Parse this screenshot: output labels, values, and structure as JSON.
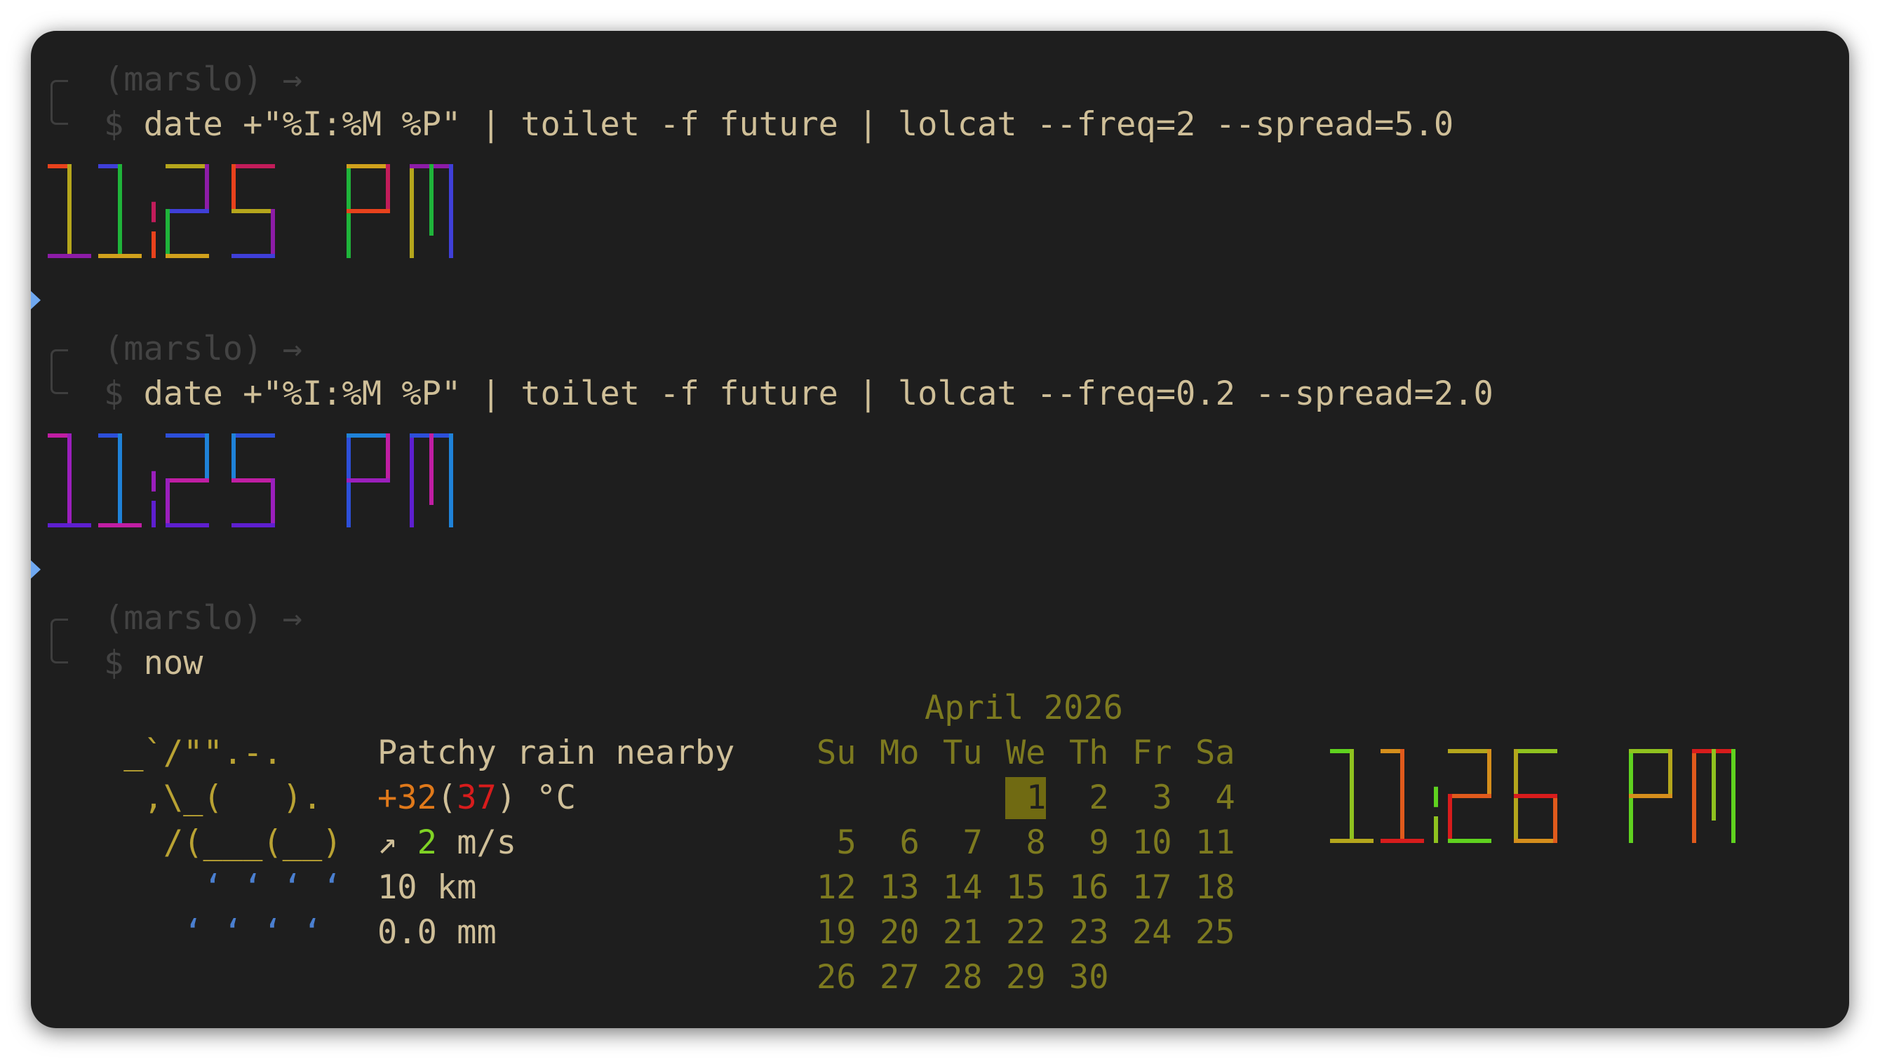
{
  "prompts": [
    {
      "context": "(marslo)",
      "arrow": "→",
      "sign": "$",
      "command": "date +\"%I:%M %P\" | toilet -f future | lolcat --freq=2 --spread=5.0"
    },
    {
      "context": "(marslo)",
      "arrow": "→",
      "sign": "$",
      "command": "date +\"%I:%M %P\" | toilet -f future | lolcat --freq=0.2 --spread=2.0"
    },
    {
      "context": "(marslo)",
      "arrow": "→",
      "sign": "$",
      "command": "now"
    }
  ],
  "clock_outputs": [
    {
      "time": "11:25 PM",
      "gradient": [
        "#e8421c",
        "#b5a61c",
        "#8d1ca7",
        "#3f3fd8",
        "#1fb43a",
        "#d0a11c",
        "#c21c5a"
      ]
    },
    {
      "time": "11:25 PM",
      "gradient": [
        "#c01ea3",
        "#9b1fbc",
        "#5e1fcf",
        "#2d4fd9",
        "#1f82d8"
      ]
    }
  ],
  "weather": {
    "art": [
      " _`/\"\".-.",
      "  ,\\_(   ).",
      "   /(___(__)",
      "     ‘ ‘ ‘ ‘",
      "    ‘ ‘ ‘ ‘"
    ],
    "condition": "Patchy rain nearby",
    "temp_prefix": "+32",
    "temp_feels": "37",
    "temp_unit": ") °C",
    "wind_arrow": "↗",
    "wind_speed": "2",
    "wind_unit": "m/s",
    "visibility": "10 km",
    "precipitation": "0.0 mm"
  },
  "calendar": {
    "title": "April 2026",
    "weekdays": [
      "Su",
      "Mo",
      "Tu",
      "We",
      "Th",
      "Fr",
      "Sa"
    ],
    "weeks": [
      [
        "",
        "",
        "",
        "1",
        "2",
        "3",
        "4"
      ],
      [
        "5",
        "6",
        "7",
        "8",
        "9",
        "10",
        "11"
      ],
      [
        "12",
        "13",
        "14",
        "15",
        "16",
        "17",
        "18"
      ],
      [
        "19",
        "20",
        "21",
        "22",
        "23",
        "24",
        "25"
      ],
      [
        "26",
        "27",
        "28",
        "29",
        "30",
        "",
        ""
      ]
    ],
    "today": "1"
  },
  "now_clock": {
    "time": "11:26 PM",
    "gradient": [
      "#5fd21f",
      "#8fc21f",
      "#b4a61c",
      "#d58e1c",
      "#e05a1c",
      "#d81c1c"
    ]
  }
}
